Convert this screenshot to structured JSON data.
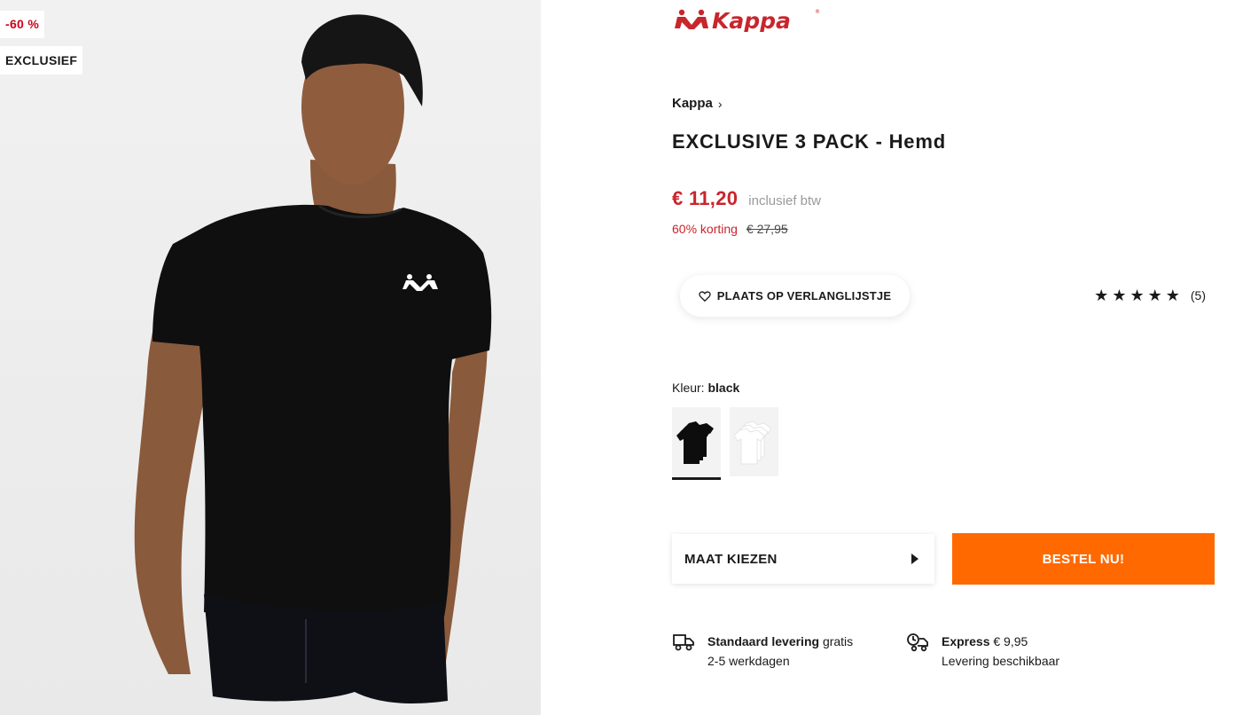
{
  "gallery": {
    "discount_badge": "-60 %",
    "exclusive_badge": "EXCLUSIEF"
  },
  "brand": {
    "logo_text": "Kappa",
    "logo_color": "#c9252c"
  },
  "breadcrumb": {
    "brand_link": "Kappa"
  },
  "product": {
    "title": "EXCLUSIVE 3 PACK - Hemd",
    "price": "€ 11,20",
    "vat_note": "inclusief btw",
    "discount_percent": "60% korting",
    "original_price": "€ 27,95"
  },
  "wishlist": {
    "label": "PLAATS OP VERLANGLIJSTJE",
    "icon": "heart-icon"
  },
  "rating": {
    "stars": 5,
    "count": "(5)"
  },
  "color": {
    "label": "Kleur:",
    "selected": "black",
    "options": [
      "black",
      "white"
    ]
  },
  "size": {
    "label": "MAAT KIEZEN"
  },
  "order": {
    "label": "BESTEL NU!",
    "color": "#ff6900"
  },
  "delivery": {
    "standard": {
      "title": "Standaard levering",
      "price": "gratis",
      "detail": "2-5 werkdagen",
      "icon": "truck-icon"
    },
    "express": {
      "title": "Express",
      "price": "€ 9,95",
      "detail": "Levering beschikbaar",
      "icon": "express-truck-icon"
    }
  }
}
